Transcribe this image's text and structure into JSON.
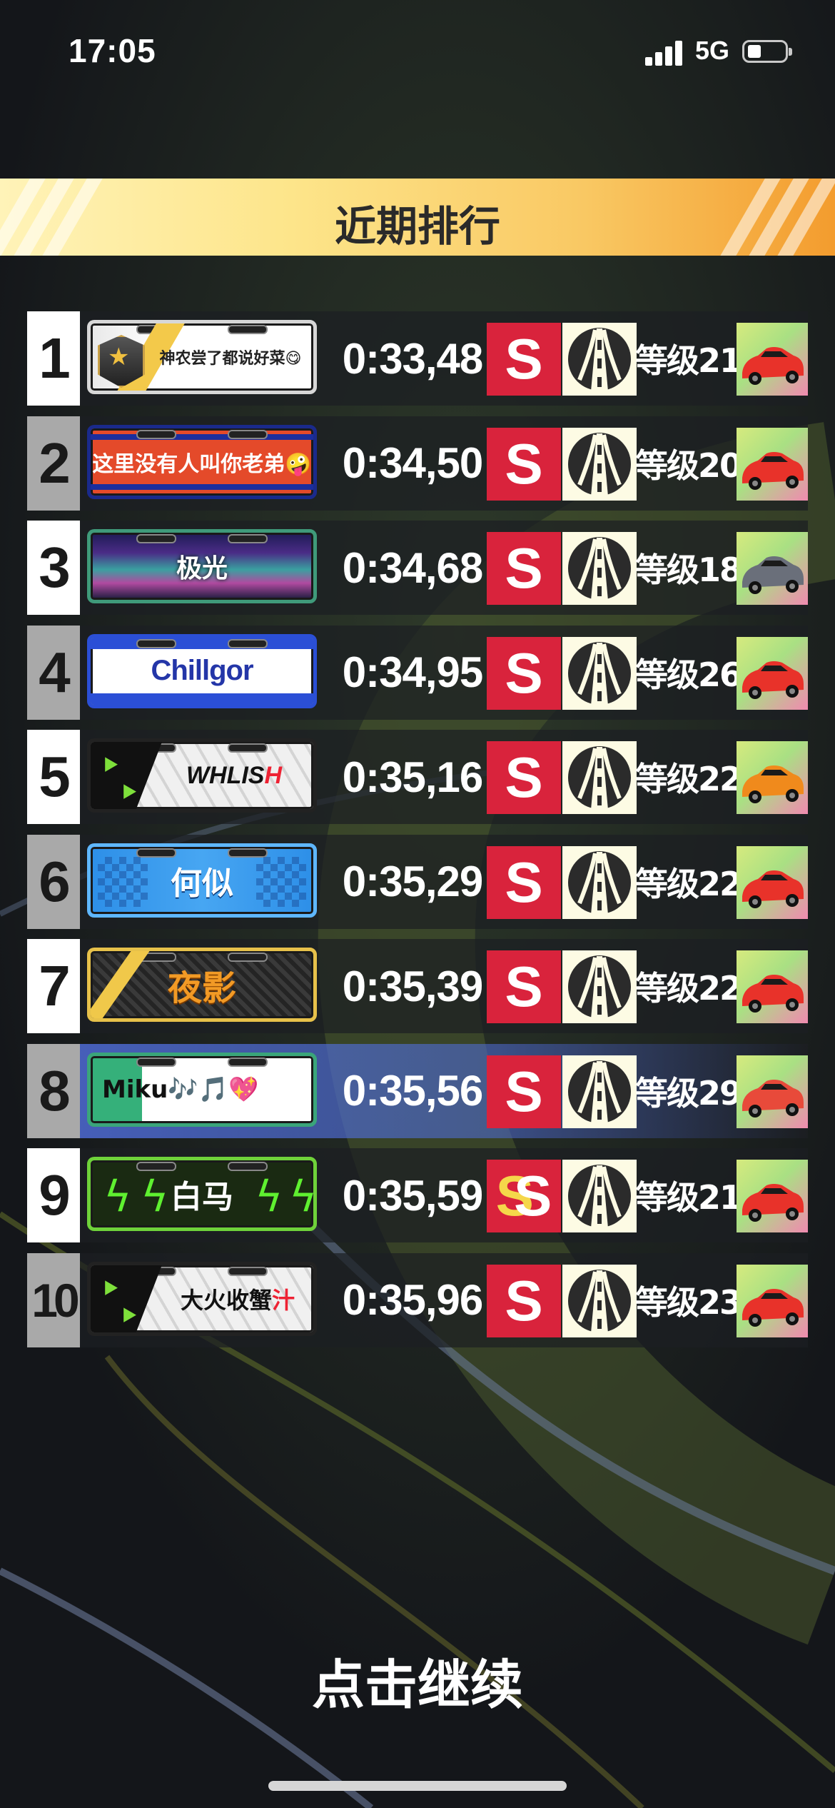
{
  "status_bar": {
    "time": "17:05",
    "network": "5G",
    "battery_level": 0.35
  },
  "title": "近期排行",
  "entries": [
    {
      "rank": "1",
      "name": "神农尝了都说好菜😋",
      "time": "0:33,48",
      "grade": "S",
      "level": "等级21",
      "plate": "p1",
      "car_color": "#e8322a"
    },
    {
      "rank": "2",
      "name": "这里没有人叫你老弟🤪",
      "time": "0:34,50",
      "grade": "S",
      "level": "等级20",
      "plate": "p2",
      "car_color": "#e8322a"
    },
    {
      "rank": "3",
      "name": "极光",
      "time": "0:34,68",
      "grade": "S",
      "level": "等级18",
      "plate": "p3",
      "car_color": "#6a6f7a"
    },
    {
      "rank": "4",
      "name": "Chillgor",
      "time": "0:34,95",
      "grade": "S",
      "level": "等级26",
      "plate": "p4",
      "car_color": "#e8322a"
    },
    {
      "rank": "5",
      "name_main": "WHLIS",
      "name_accent": "H",
      "time": "0:35,16",
      "grade": "S",
      "level": "等级22",
      "plate": "p5",
      "car_color": "#f08a1c"
    },
    {
      "rank": "6",
      "name": "何似",
      "time": "0:35,29",
      "grade": "S",
      "level": "等级22",
      "plate": "p6",
      "car_color": "#e8322a"
    },
    {
      "rank": "7",
      "name": "夜影",
      "time": "0:35,39",
      "grade": "S",
      "level": "等级22",
      "plate": "p7",
      "car_color": "#e8322a"
    },
    {
      "rank": "8",
      "name": "Miku🎶🎵💖",
      "time": "0:35,56",
      "grade": "S",
      "level": "等级29",
      "plate": "p8",
      "car_color": "#e84a3a",
      "highlight": true
    },
    {
      "rank": "9",
      "name": "白马",
      "time": "0:35,59",
      "grade": "SS",
      "level": "等级21",
      "plate": "p9",
      "car_color": "#e8322a"
    },
    {
      "rank": "10",
      "name_main": "大火收蟹",
      "name_accent": "汁",
      "time": "0:35,96",
      "grade": "S",
      "level": "等级23",
      "plate": "p10",
      "car_color": "#e8322a"
    }
  ],
  "footer": {
    "continue_label": "点击继续"
  },
  "colors": {
    "banner_start": "#fff3b8",
    "banner_end": "#f39c2e",
    "grade_bg": "#d9233c",
    "highlight_row": "#506edc"
  },
  "icons": {
    "grade": "s-grade-icon",
    "track": "road-icon",
    "car": "car-thumbnail"
  }
}
